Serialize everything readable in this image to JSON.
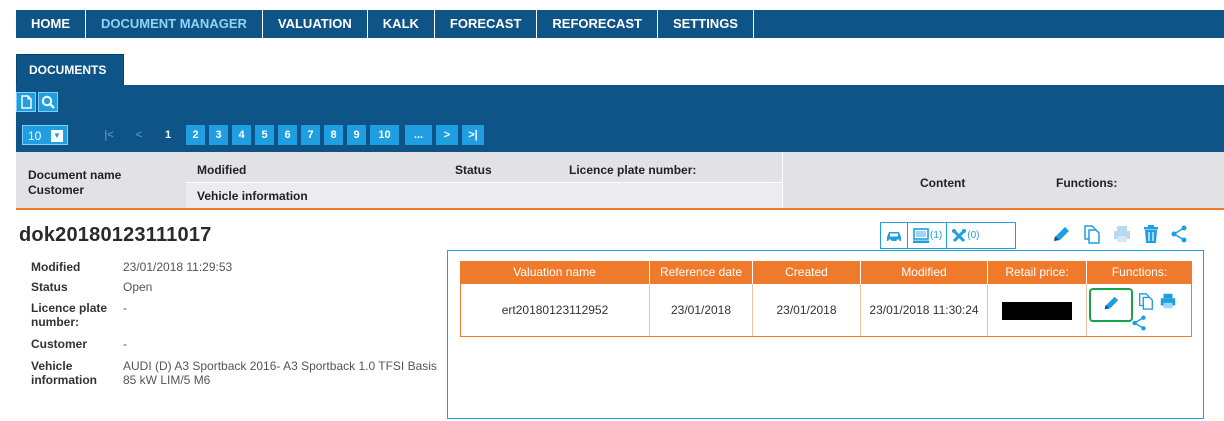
{
  "nav": {
    "items": [
      {
        "label": "HOME",
        "active": false
      },
      {
        "label": "DOCUMENT MANAGER",
        "active": true
      },
      {
        "label": "VALUATION",
        "active": false
      },
      {
        "label": "KALK",
        "active": false
      },
      {
        "label": "FORECAST",
        "active": false
      },
      {
        "label": "REFORECAST",
        "active": false
      },
      {
        "label": "SETTINGS",
        "active": false
      }
    ]
  },
  "tabs": {
    "documents": "DOCUMENTS"
  },
  "toolbar": {
    "new_icon": "new-document-icon",
    "search_icon": "search-icon"
  },
  "pager": {
    "page_size": "10",
    "first": "|<",
    "prev": "<",
    "current": "1",
    "pages": [
      "2",
      "3",
      "4",
      "5",
      "6",
      "7",
      "8",
      "9",
      "10"
    ],
    "more": "...",
    "next": ">",
    "last": ">|"
  },
  "columns": {
    "document_name": "Document name",
    "customer": "Customer",
    "modified": "Modified",
    "vehicle_information": "Vehicle information",
    "status": "Status",
    "licence_plate": "Licence plate number:",
    "content": "Content",
    "functions": "Functions:"
  },
  "document": {
    "name": "dok20180123111017",
    "fields": [
      {
        "label": "Modified",
        "value": "23/01/2018 11:29:53"
      },
      {
        "label": "Status",
        "value": "Open"
      },
      {
        "label": "Licence plate number:",
        "value": "-"
      },
      {
        "label": "Customer",
        "value": "-"
      },
      {
        "label": "Vehicle information",
        "value": "AUDI (D) A3 Sportback 2016- A3 Sportback 1.0 TFSI Basis 85 kW LIM/5 M6"
      }
    ],
    "content_counts": {
      "valuations": "(1)",
      "tools": "(0)"
    }
  },
  "valuation_table": {
    "headers": [
      "Valuation name",
      "Reference date",
      "Created",
      "Modified",
      "Retail price:",
      "Functions:"
    ],
    "rows": [
      {
        "name": "ert20180123112952",
        "reference_date": "23/01/2018",
        "created": "23/01/2018",
        "modified": "23/01/2018 11:30:24",
        "retail_price": ""
      }
    ]
  },
  "colors": {
    "nav_bg": "#0e5487",
    "accent_blue": "#1f9ee2",
    "orange": "#f07a2c",
    "highlight_green": "#17a54a"
  }
}
